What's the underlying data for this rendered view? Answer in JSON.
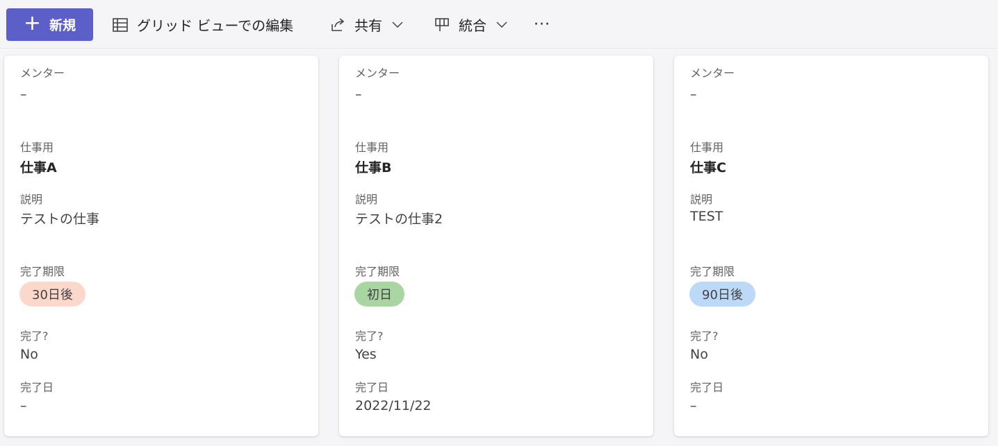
{
  "toolbar": {
    "new_label": "新規",
    "grid_edit_label": "グリッド ビューでの編集",
    "share_label": "共有",
    "merge_label": "統合",
    "more_label": "···"
  },
  "colors": {
    "accent": "#5b5fc7",
    "pill_30": "#fcd8cc",
    "pill_first": "#a8d5a2",
    "pill_90": "#bcd9f7"
  },
  "cards": [
    {
      "mentor_label": "メンター",
      "mentor_value": "–",
      "work_label": "仕事用",
      "work_value": "仕事A",
      "desc_label": "説明",
      "desc_value": "テストの仕事",
      "due_label": "完了期限",
      "due_value": "30日後",
      "done_label": "完了?",
      "done_value": "No",
      "date_label": "完了日",
      "date_value": "–"
    },
    {
      "mentor_label": "メンター",
      "mentor_value": "–",
      "work_label": "仕事用",
      "work_value": "仕事B",
      "desc_label": "説明",
      "desc_value": "テストの仕事2",
      "due_label": "完了期限",
      "due_value": "初日",
      "done_label": "完了?",
      "done_value": "Yes",
      "date_label": "完了日",
      "date_value": "2022/11/22"
    },
    {
      "mentor_label": "メンター",
      "mentor_value": "–",
      "work_label": "仕事用",
      "work_value": "仕事C",
      "desc_label": "説明",
      "desc_value": "TEST",
      "due_label": "完了期限",
      "due_value": "90日後",
      "done_label": "完了?",
      "done_value": "No",
      "date_label": "完了日",
      "date_value": "–"
    }
  ]
}
